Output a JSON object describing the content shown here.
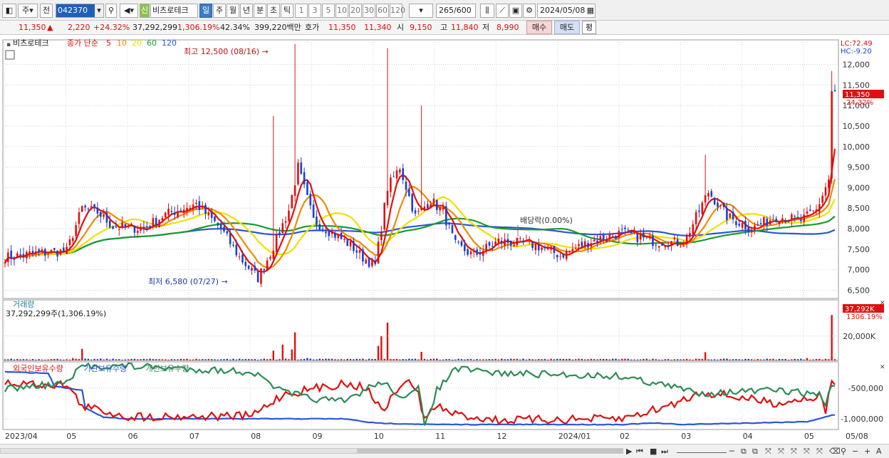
{
  "toolbar": {
    "period_btn": "주",
    "prev_btn": "전",
    "stock_code": "042370",
    "new_badge": "신",
    "stock_name": "비츠로테크",
    "period_tabs": [
      "일",
      "주",
      "월",
      "년",
      "분",
      "초",
      "틱"
    ],
    "selected_tab": "일",
    "interval_tabs": [
      "1",
      "3",
      "5",
      "10",
      "20",
      "30",
      "60",
      "120"
    ],
    "count_value": "265",
    "count_total": "/600",
    "date_value": "2024/05/08"
  },
  "quote": {
    "price": "11,350",
    "arrow": "▲",
    "change": "2,220",
    "change_pct": "+24.32%",
    "volume": "37,292,299",
    "volume_pct": "1,306.19%",
    "turnover": "42.34%",
    "amount": "399,220백만",
    "hoga_label": "호가",
    "ask": "11,350",
    "bid": "11,340",
    "open_label": "시",
    "open": "9,150",
    "high_label": "고",
    "high": "11,840",
    "low_label": "저",
    "low": "8,990",
    "buy_btn": "매수",
    "sell_btn": "매도",
    "eval_btn": "평"
  },
  "legend": {
    "stock": "비츠로테크",
    "ma_title": "종가 단순",
    "ma_periods": [
      "5",
      "10",
      "20",
      "60",
      "120"
    ]
  },
  "price_panel": {
    "lc": "LC:72.49",
    "hc": "HC:-9.20",
    "last_price": "11,350",
    "last_pct": "24.32%",
    "high_annotation": "최고 12,500 (08/16)",
    "low_annotation": "최저 6,580 (07/27)",
    "dividend": "배당락(0.00%)"
  },
  "volume_panel": {
    "title": "거래량",
    "value": "37,292,299주(1,306.19%)",
    "last_label": "37,292K",
    "last_pct": "1306.19%"
  },
  "holdings_panel": {
    "legend": [
      "외국인보유수량",
      "기관보유수량",
      "개인보유수량"
    ]
  },
  "colors": {
    "up": "#e01010",
    "down": "#1a40d0",
    "ma5": "#e01010",
    "ma10": "#f08a00",
    "ma20": "#f0e000",
    "ma60": "#1c9b2c",
    "ma120": "#2a56d8",
    "foreign": "#e01010",
    "institution": "#2a56d8",
    "individual": "#2e8b57"
  },
  "chart_data": {
    "type": "candlestick",
    "price_axis": {
      "ticks": [
        6500,
        7000,
        7500,
        8000,
        8500,
        9000,
        9500,
        10000,
        10500,
        11000,
        11500,
        12000
      ],
      "tick_labels": [
        "6,500",
        "7,000",
        "7,500",
        "8,000",
        "8,500",
        "9,000",
        "9,500",
        "10,000",
        "10,500",
        "11,000",
        "11,500",
        "12,000"
      ],
      "range": [
        6300,
        12600
      ]
    },
    "volume_axis": {
      "tick_label": "20,000K",
      "tick": 20000,
      "max": 45000
    },
    "holdings_axis": {
      "tick_labels": [
        "-500,000",
        "-1,000,000"
      ]
    },
    "x_labels": [
      "2023/04",
      "05",
      "06",
      "07",
      "08",
      "09",
      "10",
      "11",
      "12",
      "2024/01",
      "02",
      "03",
      "04",
      "05",
      "05/08"
    ],
    "price_keypoints": [
      [
        0,
        7300
      ],
      [
        10,
        7400
      ],
      [
        20,
        7450
      ],
      [
        25,
        8500
      ],
      [
        30,
        8400
      ],
      [
        35,
        8050
      ],
      [
        45,
        8000
      ],
      [
        52,
        8350
      ],
      [
        62,
        8600
      ],
      [
        70,
        8000
      ],
      [
        76,
        7300
      ],
      [
        82,
        6800
      ],
      [
        86,
        7400
      ],
      [
        92,
        8450
      ],
      [
        95,
        9500
      ],
      [
        100,
        8200
      ],
      [
        106,
        7900
      ],
      [
        112,
        7600
      ],
      [
        116,
        7300
      ],
      [
        120,
        7100
      ],
      [
        124,
        9000
      ],
      [
        128,
        9500
      ],
      [
        133,
        8300
      ],
      [
        138,
        8700
      ],
      [
        142,
        8400
      ],
      [
        146,
        7600
      ],
      [
        152,
        7350
      ],
      [
        160,
        7700
      ],
      [
        172,
        7600
      ],
      [
        180,
        7350
      ],
      [
        190,
        7700
      ],
      [
        200,
        7900
      ],
      [
        210,
        7700
      ],
      [
        220,
        7650
      ],
      [
        228,
        8900
      ],
      [
        234,
        8300
      ],
      [
        242,
        8000
      ],
      [
        250,
        8300
      ],
      [
        258,
        8200
      ],
      [
        263,
        8450
      ],
      [
        267,
        9200
      ],
      [
        268,
        11350
      ]
    ],
    "spikes": [
      {
        "i": 87,
        "h": 10750
      },
      {
        "i": 94,
        "h": 12500
      },
      {
        "i": 124,
        "h": 12400
      },
      {
        "i": 135,
        "h": 11000
      },
      {
        "i": 227,
        "h": 9800
      },
      {
        "i": 268,
        "h": 11840
      }
    ],
    "volume_keypoints": [
      [
        0,
        800
      ],
      [
        22,
        2000
      ],
      [
        25,
        9500
      ],
      [
        40,
        900
      ],
      [
        84,
        1500
      ],
      [
        87,
        8000
      ],
      [
        90,
        13000
      ],
      [
        93,
        9000
      ],
      [
        94,
        23000
      ],
      [
        98,
        2000
      ],
      [
        121,
        12000
      ],
      [
        122,
        20000
      ],
      [
        124,
        31000
      ],
      [
        135,
        7000
      ],
      [
        140,
        1500
      ],
      [
        227,
        6800
      ],
      [
        260,
        2000
      ],
      [
        268,
        37292
      ]
    ]
  }
}
